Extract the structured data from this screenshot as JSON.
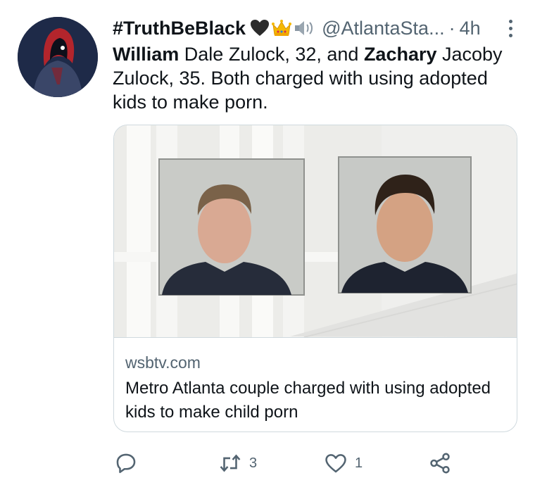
{
  "tweet": {
    "display_name": "#TruthBeBlack",
    "emojis": [
      "black-heart-icon",
      "crown-icon",
      "speaker-icon"
    ],
    "handle": "@AtlantaSta...",
    "separator": "·",
    "time": "4h",
    "text_parts": {
      "name1": "William",
      "mid1": " Dale Zulock, 32, and ",
      "name2": "Zachary",
      "mid2": " Jacoby Zulock, 35.  Both charged with using adopted kids to make porn."
    }
  },
  "card": {
    "domain": "wsbtv.com",
    "title": "Metro Atlanta couple charged with using adopted kids to make child porn"
  },
  "actions": {
    "reply_icon": "reply-icon",
    "retweet_icon": "retweet-icon",
    "retweet_count": "3",
    "like_icon": "heart-icon",
    "like_count": "1",
    "share_icon": "share-icon"
  },
  "colors": {
    "text": "#0f1419",
    "secondary": "#536471",
    "border": "#cfd9de"
  }
}
